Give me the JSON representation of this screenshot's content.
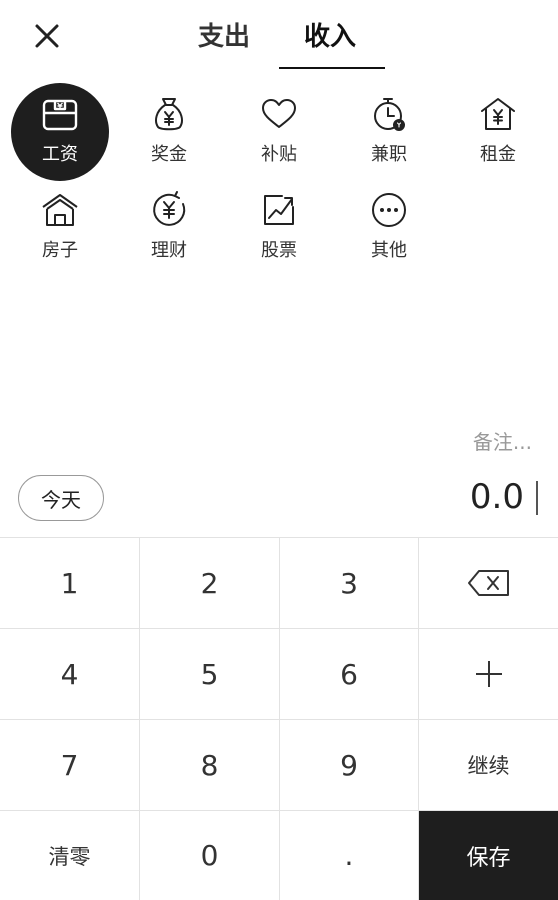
{
  "header": {
    "tabs": [
      {
        "label": "支出"
      },
      {
        "label": "收入"
      }
    ]
  },
  "categories": [
    {
      "label": "工资",
      "icon": "wallet-yen-icon"
    },
    {
      "label": "奖金",
      "icon": "money-bag-icon"
    },
    {
      "label": "补贴",
      "icon": "heart-icon"
    },
    {
      "label": "兼职",
      "icon": "stopwatch-coin-icon"
    },
    {
      "label": "租金",
      "icon": "house-yen-icon"
    },
    {
      "label": "房子",
      "icon": "houses-icon"
    },
    {
      "label": "理财",
      "icon": "circle-yen-icon"
    },
    {
      "label": "股票",
      "icon": "trend-chart-icon"
    },
    {
      "label": "其他",
      "icon": "more-dots-icon"
    }
  ],
  "entry": {
    "remark_placeholder": "备注...",
    "date_label": "今天",
    "amount": "0.0"
  },
  "keypad": {
    "k1": "1",
    "k2": "2",
    "k3": "3",
    "k4": "4",
    "k5": "5",
    "k6": "6",
    "k7": "7",
    "k8": "8",
    "k9": "9",
    "k0": "0",
    "dot": ".",
    "plus": "+",
    "continue_label": "继续",
    "clear_label": "清零",
    "save_label": "保存"
  }
}
